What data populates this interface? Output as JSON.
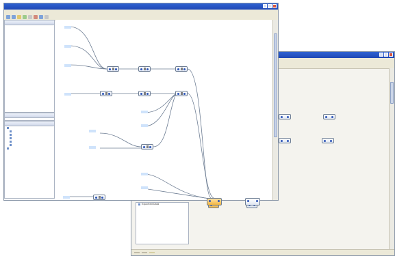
{
  "back_window": {
    "title": "",
    "tree_item": "Exported Data",
    "status_segments": [
      "",
      "",
      ""
    ],
    "canvas_labels": [
      "",
      "",
      "",
      "",
      "",
      ""
    ]
  },
  "front_window": {
    "title": "",
    "menus": [
      "",
      "",
      "",
      "",
      "",
      "",
      "",
      ""
    ],
    "panel_headers": [
      "",
      "",
      ""
    ],
    "tree_items": [
      "",
      "",
      "",
      "",
      "",
      "",
      "",
      ""
    ],
    "node_labels": [
      "",
      "",
      "",
      "",
      "",
      "",
      "",
      "",
      "",
      "",
      "",
      "",
      "",
      "",
      "",
      "",
      "",
      ""
    ],
    "source_labels": [
      "",
      "",
      "",
      "",
      "",
      "",
      "",
      ""
    ]
  },
  "colors": {
    "title_blue": "#2f62d2",
    "chrome": "#ece9d8",
    "node_port": "#2d55b8",
    "label_blue": "#1d3f9b",
    "link_line": "#6d7d93"
  },
  "icons": [
    "window-close-icon",
    "window-maximize-icon",
    "window-minimize-icon",
    "toolbar-icon",
    "tree-node-icon",
    "node-port-icon"
  ]
}
